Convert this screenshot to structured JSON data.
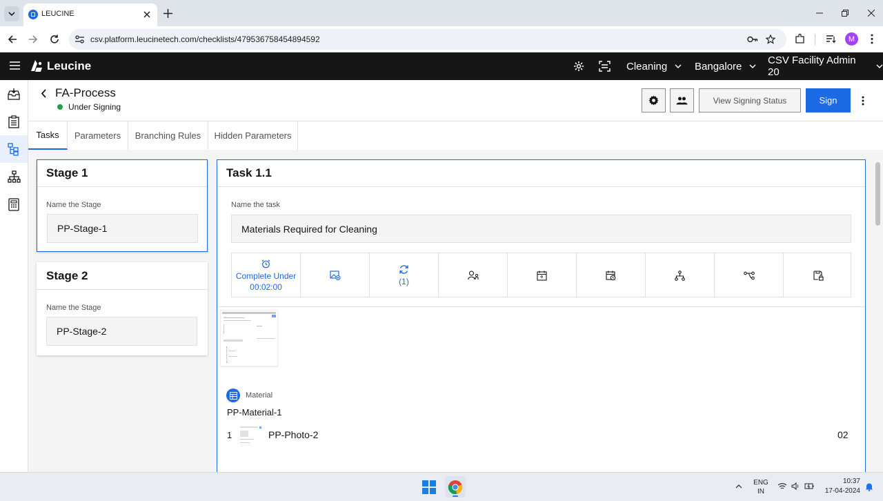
{
  "browser": {
    "tab_title": "LEUCINE",
    "url": "csv.platform.leucinetech.com/checklists/479536758454894592",
    "profile_initial": "M"
  },
  "app": {
    "brand": "Leucine",
    "header": {
      "dropdown_1": "Cleaning",
      "dropdown_2": "Bangalore",
      "dropdown_3": "CSV Facility Admin 20"
    }
  },
  "page": {
    "title": "FA-Process",
    "status": "Under Signing",
    "status_color": "#24a148",
    "view_signing_label": "View Signing Status",
    "sign_label": "Sign",
    "accent": "#1d6ae5"
  },
  "tabs": [
    {
      "label": "Tasks"
    },
    {
      "label": "Parameters"
    },
    {
      "label": "Branching Rules"
    },
    {
      "label": "Hidden Parameters"
    }
  ],
  "stages": [
    {
      "title": "Stage 1",
      "field_label": "Name the Stage",
      "value": "PP-Stage-1"
    },
    {
      "title": "Stage 2",
      "field_label": "Name the Stage",
      "value": "PP-Stage-2"
    }
  ],
  "task": {
    "title": "Task 1.1",
    "field_label": "Name the task",
    "value": "Materials Required for Cleaning",
    "timer_line1": "Complete Under",
    "timer_line2": "00:02:00",
    "recurrence_count": "(1)",
    "material_label": "Material",
    "material_name": "PP-Material-1",
    "item_index": "1",
    "item_name": "PP-Photo-2",
    "item_qty": "02"
  },
  "taskbar": {
    "lang_line1": "ENG",
    "lang_line2": "IN",
    "time": "10:37",
    "date": "17-04-2024"
  }
}
